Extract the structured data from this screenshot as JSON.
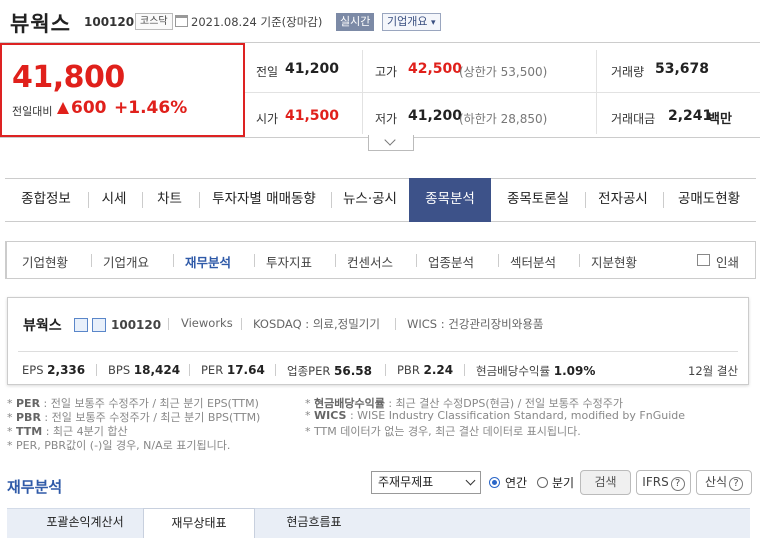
{
  "header": {
    "stock_name": "뷰웍스",
    "stock_code": "100120",
    "market": "코스닥",
    "date": "2021.08.24 기준(장마감)",
    "realtime_label": "실시간",
    "overview_label": "기업개요"
  },
  "price": {
    "current": "41,800",
    "change_label": "전일대비",
    "change_value": "600",
    "change_pct": "+1.46%",
    "direction": "up",
    "prev_close_label": "전일",
    "prev_close": "41,200",
    "high_label": "고가",
    "high": "42,500",
    "upper_limit_label": "(상한가 53,500)",
    "volume_label": "거래량",
    "volume": "53,678",
    "open_label": "시가",
    "open": "41,500",
    "low_label": "저가",
    "low": "41,200",
    "lower_limit_label": "(하한가 28,850)",
    "amount_label": "거래대금",
    "amount": "2,241",
    "amount_unit": "백만"
  },
  "main_tabs": [
    "종합정보",
    "시세",
    "차트",
    "투자자별 매매동향",
    "뉴스·공시",
    "종목분석",
    "종목토론실",
    "전자공시",
    "공매도현황"
  ],
  "main_tab_active": "종목분석",
  "sub_tabs": [
    "기업현황",
    "기업개요",
    "재무분석",
    "투자지표",
    "컨센서스",
    "업종분석",
    "섹터분석",
    "지분현황"
  ],
  "sub_tab_active": "재무분석",
  "print_label": "인쇄",
  "company": {
    "name": "뷰웍스",
    "code": "100120",
    "english_name": "Vieworks",
    "kosdaq_sector": "KOSDAQ : 의료,정밀기기",
    "wics_sector": "WICS : 건강관리장비와용품",
    "metrics": {
      "eps_label": "EPS",
      "eps": "2,336",
      "bps_label": "BPS",
      "bps": "18,424",
      "per_label": "PER",
      "per": "17.64",
      "industry_per_label": "업종PER",
      "industry_per": "56.58",
      "pbr_label": "PBR",
      "pbr": "2.24",
      "dividend_label": "현금배당수익률",
      "dividend": "1.09%"
    },
    "settlement": "12월 결산"
  },
  "notes": {
    "per_key": "PER",
    "per_text": ": 전일 보통주 수정주가 / 최근 분기 EPS(TTM)",
    "pbr_key": "PBR",
    "pbr_text": ": 전일 보통주 수정주가 / 최근 분기 BPS(TTM)",
    "ttm_key": "TTM",
    "ttm_text": ": 최근 4분기 합산",
    "negative_text": "* PER, PBR값이 (-)일 경우, N/A로 표기됩니다.",
    "dividend_key": "현금배당수익률",
    "dividend_text": ": 최근 결산 수정DPS(현금) / 전일 보통주 수정주가",
    "wics_key": "WICS",
    "wics_text": ": WISE Industry Classification Standard, modified by FnGuide",
    "ttm_missing_text": "* TTM 데이터가 없는 경우, 최근 결산 데이터로 표시됩니다."
  },
  "financial": {
    "title": "재무분석",
    "select_value": "주재무제표",
    "radio_annual": "연간",
    "radio_quarter": "분기",
    "radio_selected": "annual",
    "search_button": "검색",
    "ifrs_button": "IFRS",
    "formula_button": "산식",
    "tabs": [
      "포괄손익계산서",
      "재무상태표",
      "현금흐름표"
    ],
    "tab_active": "재무상태표"
  },
  "colors": {
    "up_red": "#e0201b",
    "navy_tab": "#3d5289",
    "link_blue": "#2f5aa8"
  }
}
